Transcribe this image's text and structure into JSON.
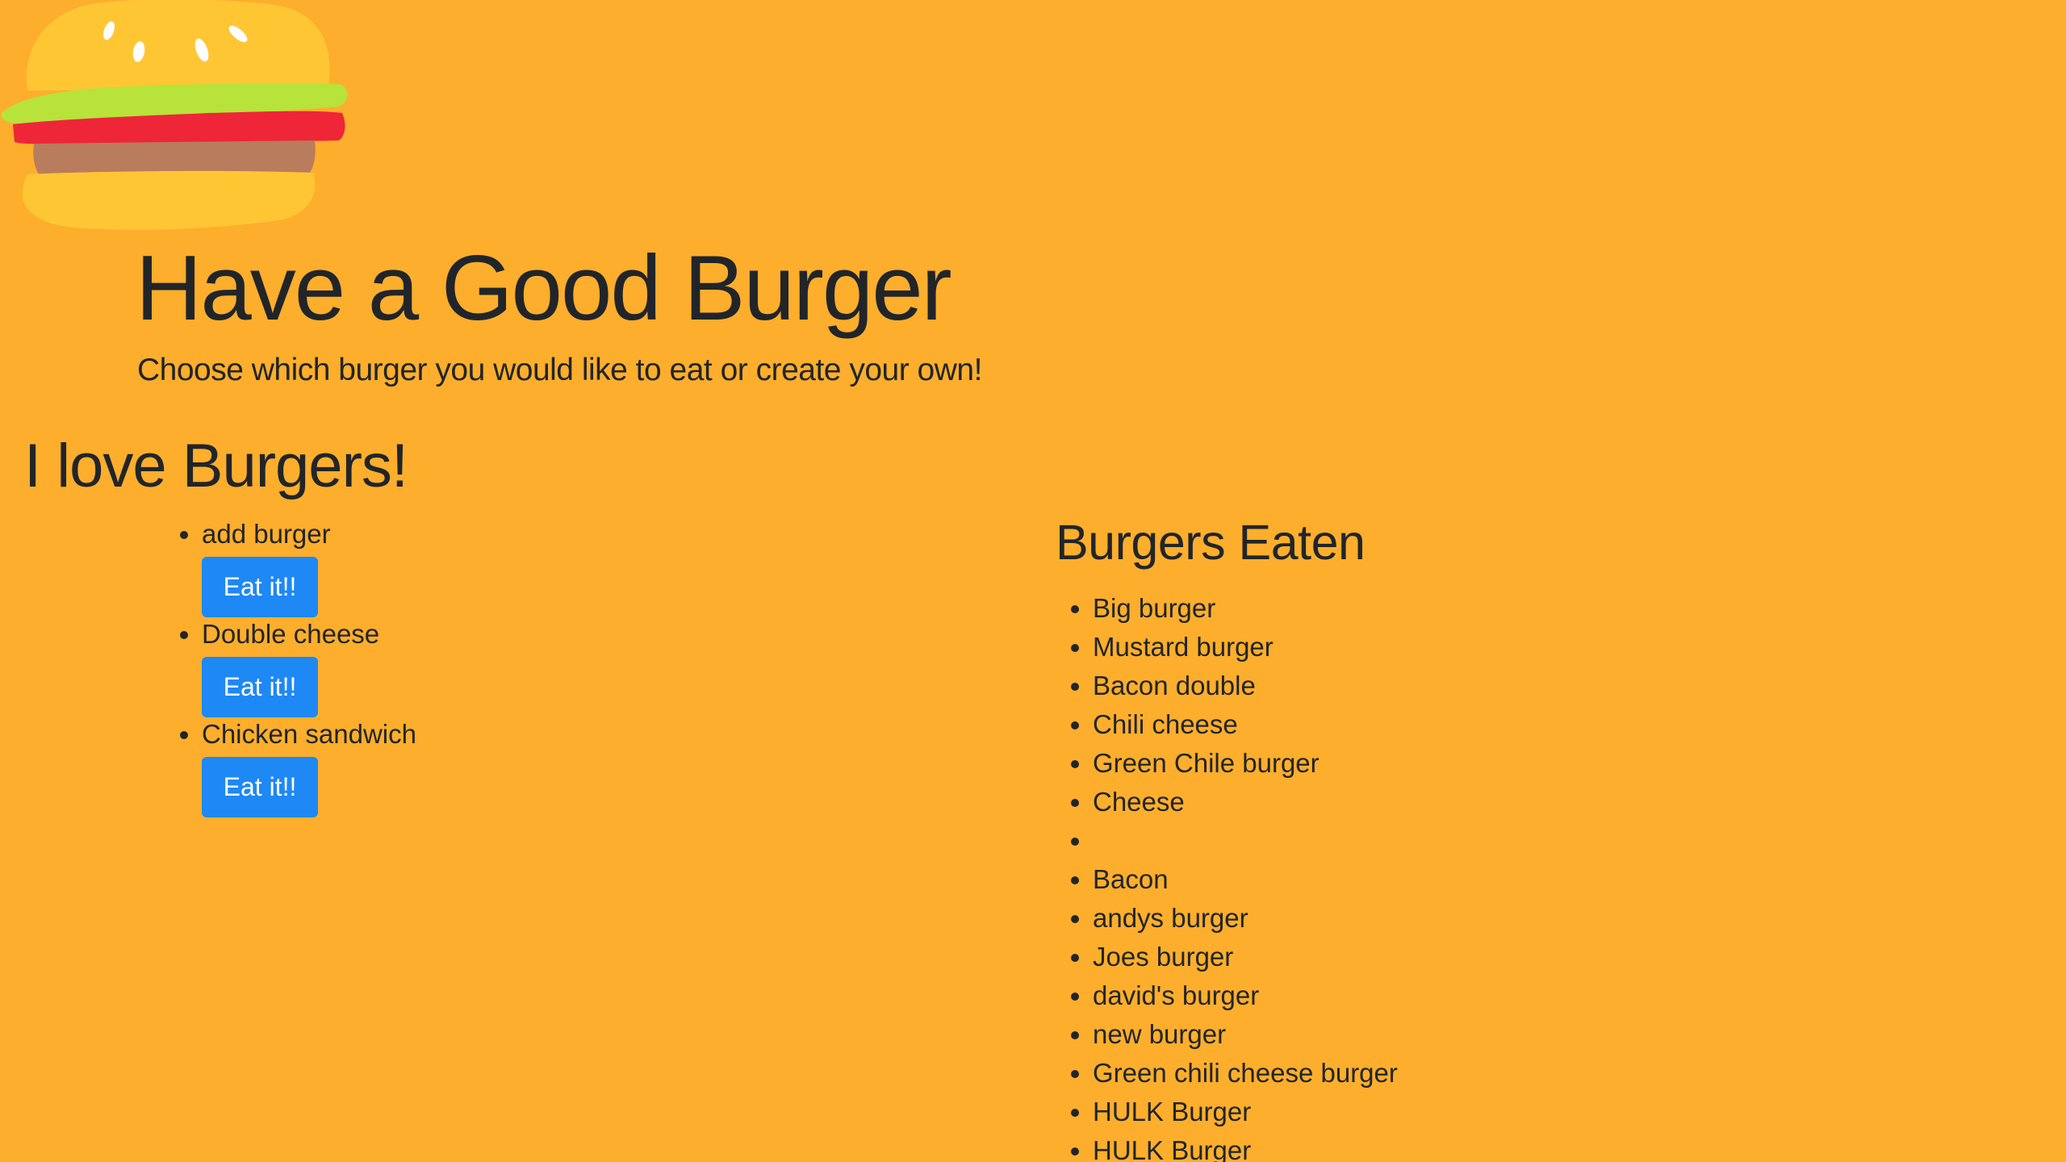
{
  "header": {
    "title": "Have a Good Burger",
    "subtitle": "Choose which burger you would like to eat or create your own!"
  },
  "logo": {
    "icon": "burger-icon",
    "colors": {
      "bun": "#FFC634",
      "lettuce": "#B7E33A",
      "tomato": "#EE2637",
      "patty": "#B97C5C",
      "seeds": "#FFFFFF"
    }
  },
  "menu": {
    "heading": "I love Burgers!",
    "items": [
      {
        "name": "add burger",
        "button_label": "Eat it!!"
      },
      {
        "name": "Double cheese",
        "button_label": "Eat it!!"
      },
      {
        "name": "Chicken sandwich",
        "button_label": "Eat it!!"
      }
    ]
  },
  "eaten": {
    "heading": "Burgers Eaten",
    "items": [
      "Big burger",
      "Mustard burger",
      "Bacon double",
      "Chili cheese",
      "Green Chile burger",
      "Cheese",
      "",
      "Bacon",
      "andys burger",
      "Joes burger",
      "david's burger",
      "new burger",
      "Green chili cheese burger",
      "HULK Burger",
      "HULK Burger"
    ]
  },
  "colors": {
    "background": "#FDAE2C",
    "button": "#1E88F5",
    "text": "#212529"
  }
}
